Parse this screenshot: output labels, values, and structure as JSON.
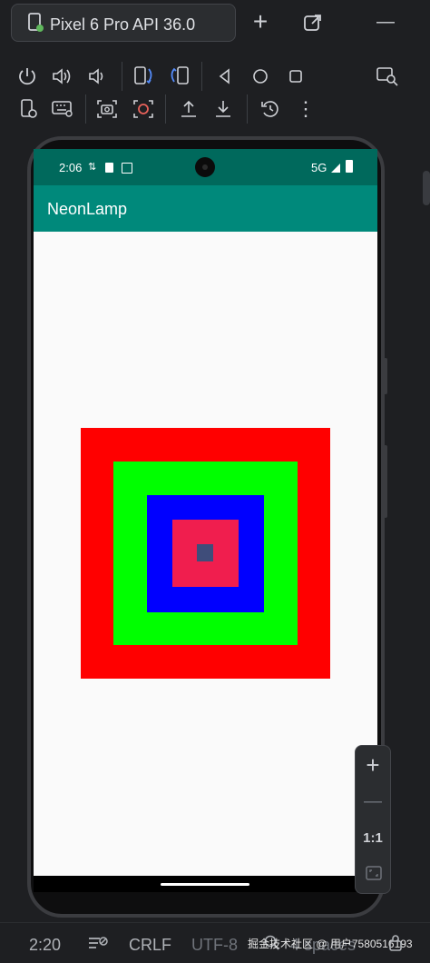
{
  "tab": {
    "title": "Pixel 6 Pro API 36.0"
  },
  "toolbar": {
    "row1_icons": [
      "power-icon",
      "volume-up-icon",
      "volume-down-icon",
      "rotate-left-icon",
      "rotate-right-icon",
      "back-icon",
      "home-icon",
      "overview-icon"
    ],
    "row2_icons": [
      "device-settings-icon",
      "keyboard-icon",
      "screenshot-icon",
      "record-icon",
      "upload-icon",
      "download-icon",
      "snapshot-icon",
      "more-icon"
    ],
    "more_label": "⋮",
    "top_plus": "+",
    "top_minus": "—"
  },
  "device": {
    "status_time": "2:06",
    "status_network": "5G",
    "app_title": "NeonLamp",
    "squares_colors": [
      "#ff0000",
      "#00ff00",
      "#0000ff",
      "#f01e4e",
      "#3f4d7a"
    ]
  },
  "zoom": {
    "plus": "+",
    "minus": "—",
    "ratio": "1:1"
  },
  "statusbar": {
    "position": "2:20",
    "line_endings": "CRLF",
    "encoding": "UTF-8",
    "indent": "4 spaces",
    "watermark": "掘金技术社区 @ 用户7580516193"
  }
}
